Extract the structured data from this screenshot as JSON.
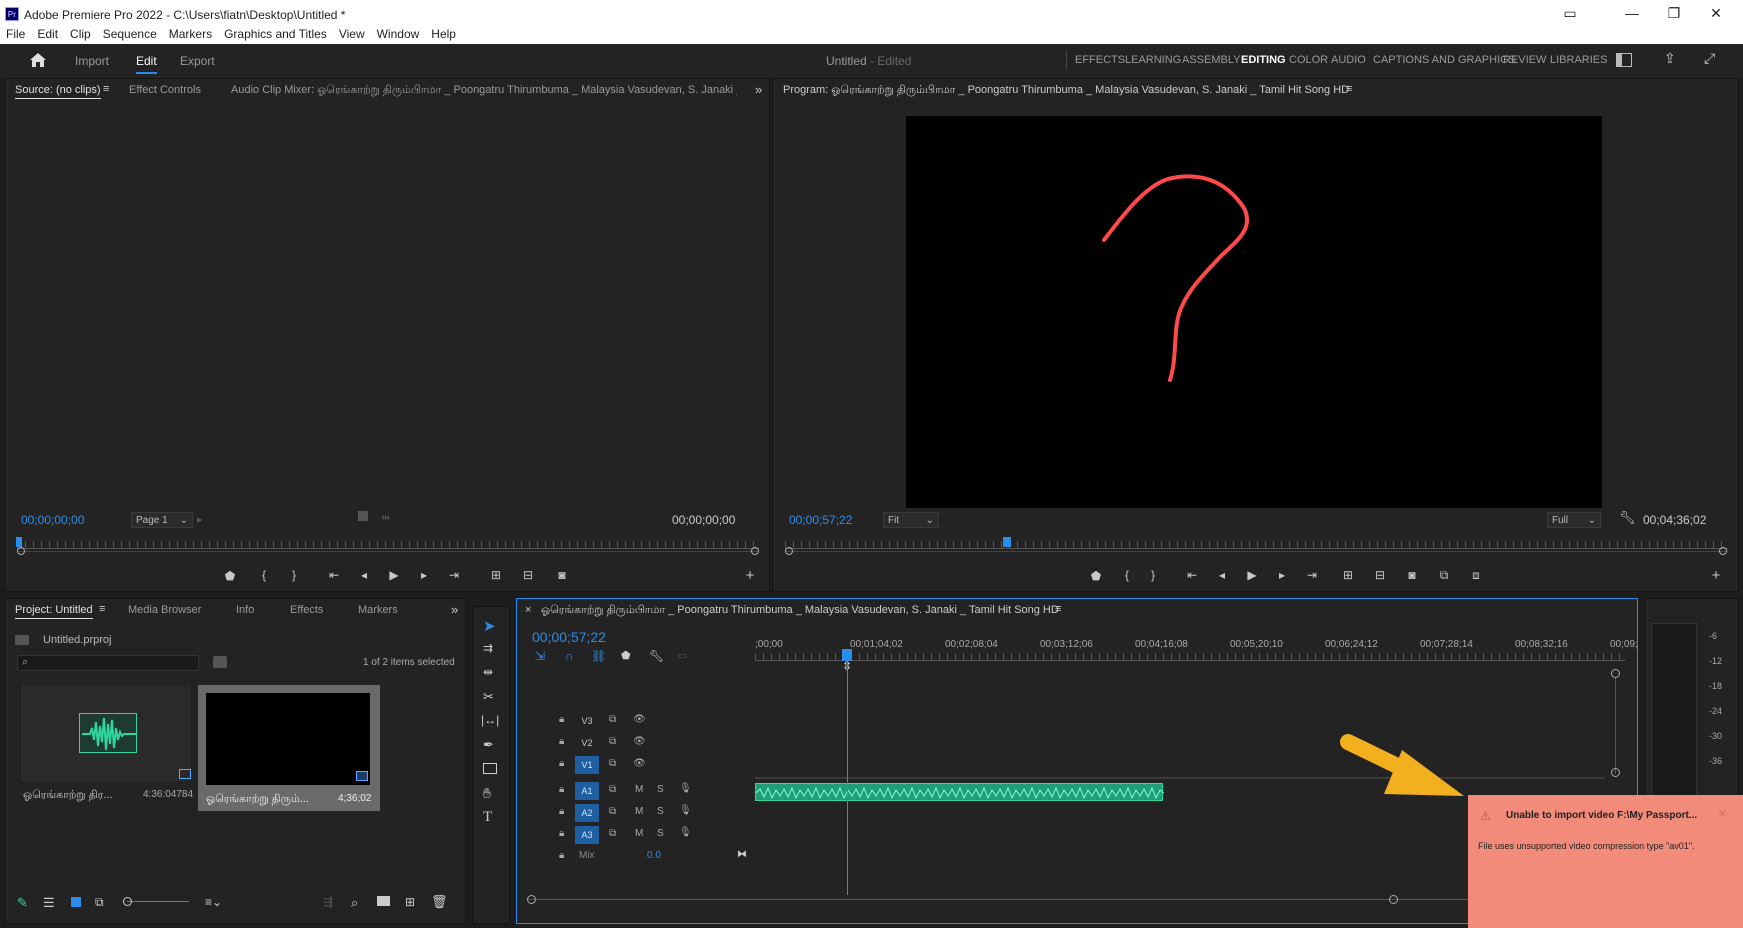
{
  "app": {
    "logo": "Pr",
    "title": "Adobe Premiere Pro 2022 - C:\\Users\\fiatn\\Desktop\\Untitled *"
  },
  "menu": [
    "File",
    "Edit",
    "Clip",
    "Sequence",
    "Markers",
    "Graphics and Titles",
    "View",
    "Window",
    "Help"
  ],
  "workspace": {
    "home_icon": "home-icon",
    "tabs": [
      "Import",
      "Edit",
      "Export"
    ],
    "active_tab": "Edit",
    "project_name": "Untitled",
    "project_state": "- Edited",
    "workspaces": [
      "EFFECTS",
      "LEARNING",
      "ASSEMBLY",
      "EDITING",
      "COLOR",
      "AUDIO",
      "CAPTIONS AND GRAPHICS",
      "REVIEW",
      "LIBRARIES"
    ],
    "active_workspace": "EDITING"
  },
  "source_panel": {
    "tabs": [
      "Source: (no clips)",
      "Effect Controls",
      "Audio Clip Mixer: ஓரெங்காற்று திரும்பிாமா _ Poongatru Thirumbuma _ Malaysia Vasudevan, S. Janaki _"
    ],
    "timecode_in": "00;00;00;00",
    "page": "Page 1",
    "timecode_out": "00;00;00;00"
  },
  "program_panel": {
    "title": "Program: ஓரெங்காற்று திரும்பிாமா _ Poongatru Thirumbuma _ Malaysia Vasudevan, S. Janaki _ Tamil Hit Song HD",
    "timecode": "00;00;57;22",
    "fit": "Fit",
    "resolution": "Full",
    "duration": "00;04;36;02",
    "playhead_fraction": 0.235
  },
  "project_panel": {
    "tabs": [
      "Project: Untitled",
      "Media Browser",
      "Info",
      "Effects",
      "Markers"
    ],
    "file": "Untitled.prproj",
    "search_placeholder": "",
    "selection_info": "1 of 2 items selected",
    "items": [
      {
        "name": "ஓரெங்காற்று திர...",
        "duration": "4:36:04784"
      },
      {
        "name": "ஓரெங்காற்று திரும்...",
        "duration": "4;36;02"
      }
    ]
  },
  "timeline": {
    "sequence_title": "ஓரெங்காற்று திரும்பிாமா _ Poongatru Thirumbuma _ Malaysia Vasudevan, S. Janaki _ Tamil Hit Song HD",
    "timecode": "00;00;57;22",
    "ruler_labels": [
      ";00;00",
      "00;01;04;02",
      "00;02;08;04",
      "00;03;12;06",
      "00;04;16;08",
      "00;05;20;10",
      "00;06;24;12",
      "00;07;28;14",
      "00;08;32;16",
      "00;09;"
    ],
    "video_tracks": [
      "V3",
      "V2",
      "V1"
    ],
    "audio_tracks": [
      "A1",
      "A2",
      "A3"
    ],
    "mix_label": "Mix",
    "mix_value": "0.0",
    "track_buttons": {
      "mute": "M",
      "solo": "S"
    }
  },
  "meter": {
    "scale": [
      "-6",
      "-12",
      "-18",
      "-24",
      "-30",
      "-36"
    ]
  },
  "toast": {
    "title": "Unable to import video F:\\My Passport...",
    "body": "File uses unsupported video compression type \"av01\".",
    "close": "×",
    "color": "#f28b7a"
  },
  "colors": {
    "accent": "#2d8ceb",
    "audio_clip": "#2fd6a0",
    "arrow": "#f2b01e",
    "drawing": "#ff4a4a"
  }
}
